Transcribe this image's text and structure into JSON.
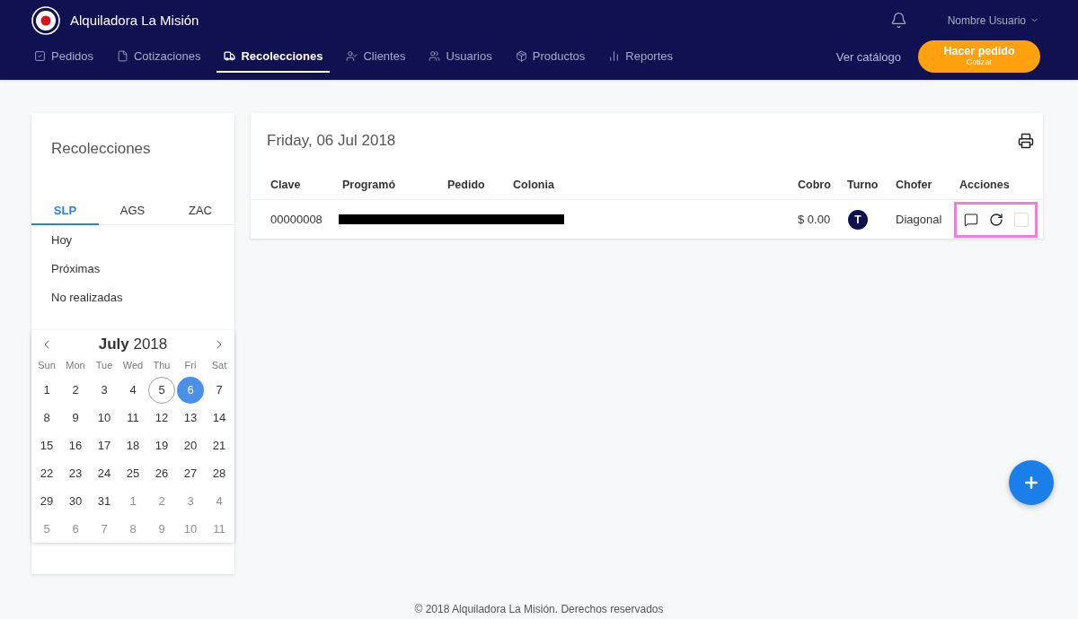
{
  "header": {
    "brand": "Alquiladora La Misión",
    "user": "Nombre Usuario",
    "nav": [
      {
        "label": "Pedidos",
        "selected": false
      },
      {
        "label": "Cotizaciones",
        "selected": false
      },
      {
        "label": "Recolecciones",
        "selected": true
      },
      {
        "label": "Clientes",
        "selected": false
      },
      {
        "label": "Usuarios",
        "selected": false
      },
      {
        "label": "Productos",
        "selected": false
      },
      {
        "label": "Reportes",
        "selected": false
      }
    ],
    "catalog_link": "Ver catálogo",
    "order_button": {
      "label": "Hacer pedido",
      "sublabel": "Cotizar"
    }
  },
  "sidebar": {
    "title": "Recolecciones",
    "tabs": [
      {
        "label": "SLP",
        "selected": true
      },
      {
        "label": "AGS",
        "selected": false
      },
      {
        "label": "ZAC",
        "selected": false
      }
    ],
    "items": [
      "Hoy",
      "Próximas",
      "No realizadas"
    ],
    "calendar": {
      "title": "**July** 2018",
      "weekdays": [
        "Sun",
        "Mon",
        "Tue",
        "Wed",
        "Thu",
        "Fri",
        "Sat"
      ],
      "days": [
        {
          "label": "1",
          "selected": false,
          "today": false,
          "muted": false
        },
        {
          "label": "2",
          "selected": false,
          "today": false,
          "muted": false
        },
        {
          "label": "3",
          "selected": false,
          "today": false,
          "muted": false
        },
        {
          "label": "4",
          "selected": false,
          "today": false,
          "muted": false
        },
        {
          "label": "5",
          "selected": false,
          "today": true,
          "muted": false
        },
        {
          "label": "6",
          "selected": true,
          "today": false,
          "muted": false
        },
        {
          "label": "7",
          "selected": false,
          "today": false,
          "muted": false
        },
        {
          "label": "8",
          "selected": false,
          "today": false,
          "muted": false
        },
        {
          "label": "9",
          "selected": false,
          "today": false,
          "muted": false
        },
        {
          "label": "10",
          "selected": false,
          "today": false,
          "muted": false
        },
        {
          "label": "11",
          "selected": false,
          "today": false,
          "muted": false
        },
        {
          "label": "12",
          "selected": false,
          "today": false,
          "muted": false
        },
        {
          "label": "13",
          "selected": false,
          "today": false,
          "muted": false
        },
        {
          "label": "14",
          "selected": false,
          "today": false,
          "muted": false
        },
        {
          "label": "15",
          "selected": false,
          "today": false,
          "muted": false
        },
        {
          "label": "16",
          "selected": false,
          "today": false,
          "muted": false
        },
        {
          "label": "17",
          "selected": false,
          "today": false,
          "muted": false
        },
        {
          "label": "18",
          "selected": false,
          "today": false,
          "muted": false
        },
        {
          "label": "19",
          "selected": false,
          "today": false,
          "muted": false
        },
        {
          "label": "20",
          "selected": false,
          "today": false,
          "muted": false
        },
        {
          "label": "21",
          "selected": false,
          "today": false,
          "muted": false
        },
        {
          "label": "22",
          "selected": false,
          "today": false,
          "muted": false
        },
        {
          "label": "23",
          "selected": false,
          "today": false,
          "muted": false
        },
        {
          "label": "24",
          "selected": false,
          "today": false,
          "muted": false
        },
        {
          "label": "25",
          "selected": false,
          "today": false,
          "muted": false
        },
        {
          "label": "26",
          "selected": false,
          "today": false,
          "muted": false
        },
        {
          "label": "27",
          "selected": false,
          "today": false,
          "muted": false
        },
        {
          "label": "28",
          "selected": false,
          "today": false,
          "muted": false
        },
        {
          "label": "29",
          "selected": false,
          "today": false,
          "muted": false
        },
        {
          "label": "30",
          "selected": false,
          "today": false,
          "muted": false
        },
        {
          "label": "31",
          "selected": false,
          "today": false,
          "muted": false
        },
        {
          "label": "1",
          "selected": false,
          "today": false,
          "muted": true
        },
        {
          "label": "2",
          "selected": false,
          "today": false,
          "muted": true
        },
        {
          "label": "3",
          "selected": false,
          "today": false,
          "muted": true
        },
        {
          "label": "4",
          "selected": false,
          "today": false,
          "muted": true
        },
        {
          "label": "5",
          "selected": false,
          "today": false,
          "muted": true
        },
        {
          "label": "6",
          "selected": false,
          "today": false,
          "muted": true
        },
        {
          "label": "7",
          "selected": false,
          "today": false,
          "muted": true
        },
        {
          "label": "8",
          "selected": false,
          "today": false,
          "muted": true
        },
        {
          "label": "9",
          "selected": false,
          "today": false,
          "muted": true
        },
        {
          "label": "10",
          "selected": false,
          "today": false,
          "muted": true
        },
        {
          "label": "11",
          "selected": false,
          "today": false,
          "muted": true
        }
      ]
    }
  },
  "schedule": {
    "date": "Friday, 06 Jul 2018",
    "columns": [
      "Clave",
      "Programó",
      "Pedido",
      "Colonia",
      "Cobro",
      "Turno",
      "Chofer",
      "Acciones"
    ],
    "rows": [
      {
        "clave": "00000008",
        "redacted": true,
        "cobro": "$ 0.00",
        "turno": "T",
        "chofer": "Diagonal",
        "actions_highlighted": true,
        "checked": false
      }
    ]
  },
  "footer": "© 2018 Alquiladora La Misión. Derechos reservados"
}
